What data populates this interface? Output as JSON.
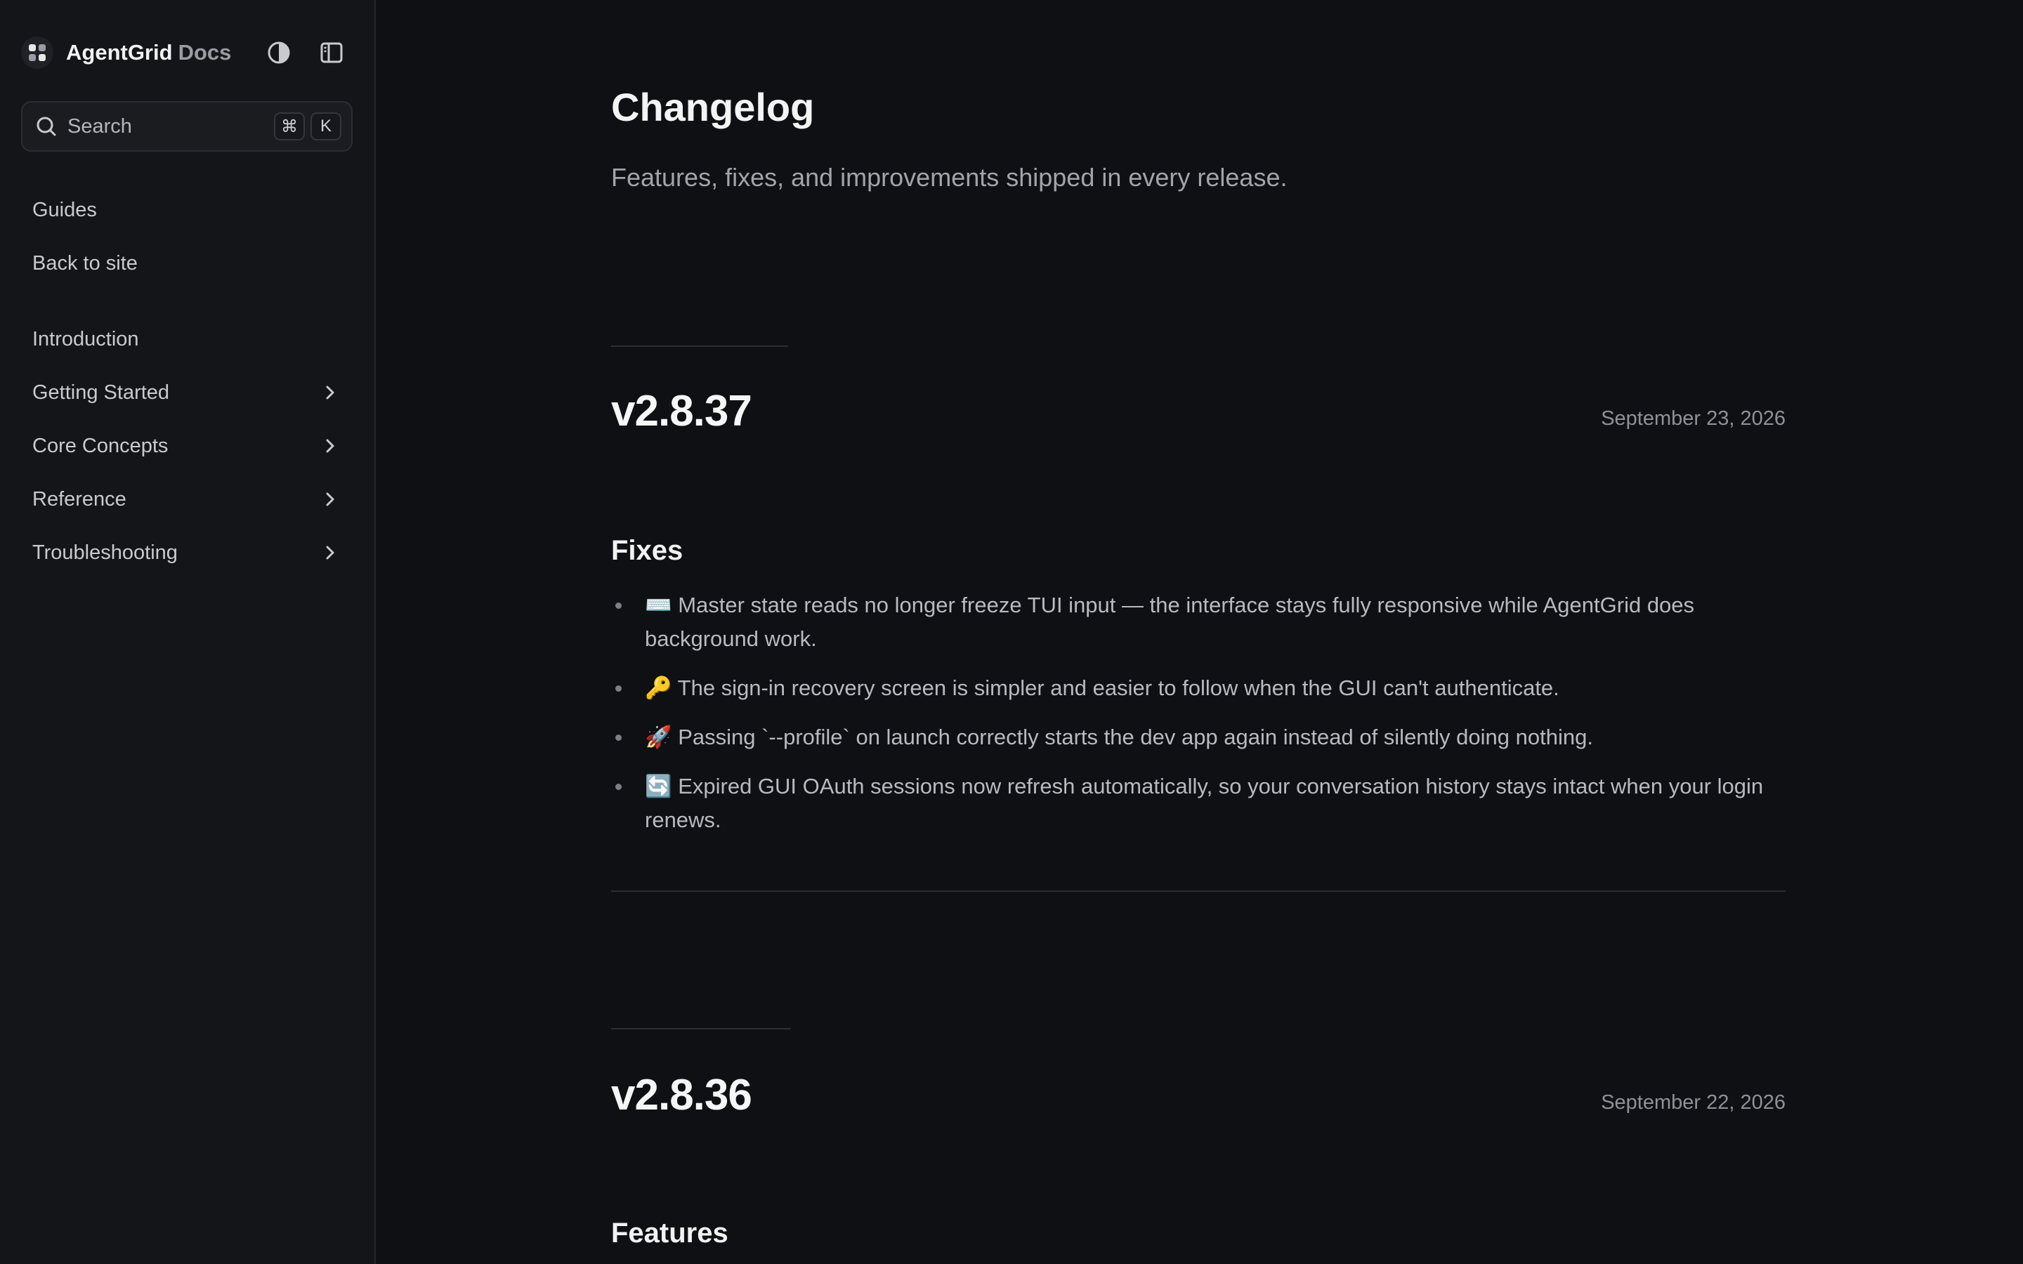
{
  "brand": {
    "name": "AgentGrid",
    "suffix": "Docs"
  },
  "icons": {
    "logo": "agentgrid-logo-icon",
    "theme_toggle": "contrast-icon",
    "sidebar_toggle": "sidebar-panel-icon",
    "search": "search-icon",
    "chevron": "chevron-right-icon"
  },
  "search": {
    "label": "Search",
    "shortcut_mod": "⌘",
    "shortcut_key": "K"
  },
  "sidebar": {
    "top_links": [
      {
        "label": "Guides"
      },
      {
        "label": "Back to site"
      }
    ],
    "sections": [
      {
        "label": "Introduction",
        "expandable": false
      },
      {
        "label": "Getting Started",
        "expandable": true
      },
      {
        "label": "Core Concepts",
        "expandable": true
      },
      {
        "label": "Reference",
        "expandable": true
      },
      {
        "label": "Troubleshooting",
        "expandable": true
      }
    ]
  },
  "page": {
    "title": "Changelog",
    "subtitle": "Features, fixes, and improvements shipped in every release."
  },
  "releases": [
    {
      "version": "v2.8.37",
      "date": "September 23, 2026",
      "section": "Fixes",
      "items": [
        "⌨️ Master state reads no longer freeze TUI input — the interface stays fully responsive while AgentGrid does background work.",
        "🔑 The sign-in recovery screen is simpler and easier to follow when the GUI can't authenticate.",
        "🚀 Passing `--profile` on launch correctly starts the dev app again instead of silently doing nothing.",
        "🔄 Expired GUI OAuth sessions now refresh automatically, so your conversation history stays intact when your login renews."
      ]
    },
    {
      "version": "v2.8.36",
      "date": "September 22, 2026",
      "section": "Features"
    }
  ],
  "colors": {
    "background": "#0f1013",
    "sidebar": "#141518",
    "text_primary": "#f4f4f4",
    "text_secondary": "#a2a4aa",
    "border": "#2c2e34"
  }
}
